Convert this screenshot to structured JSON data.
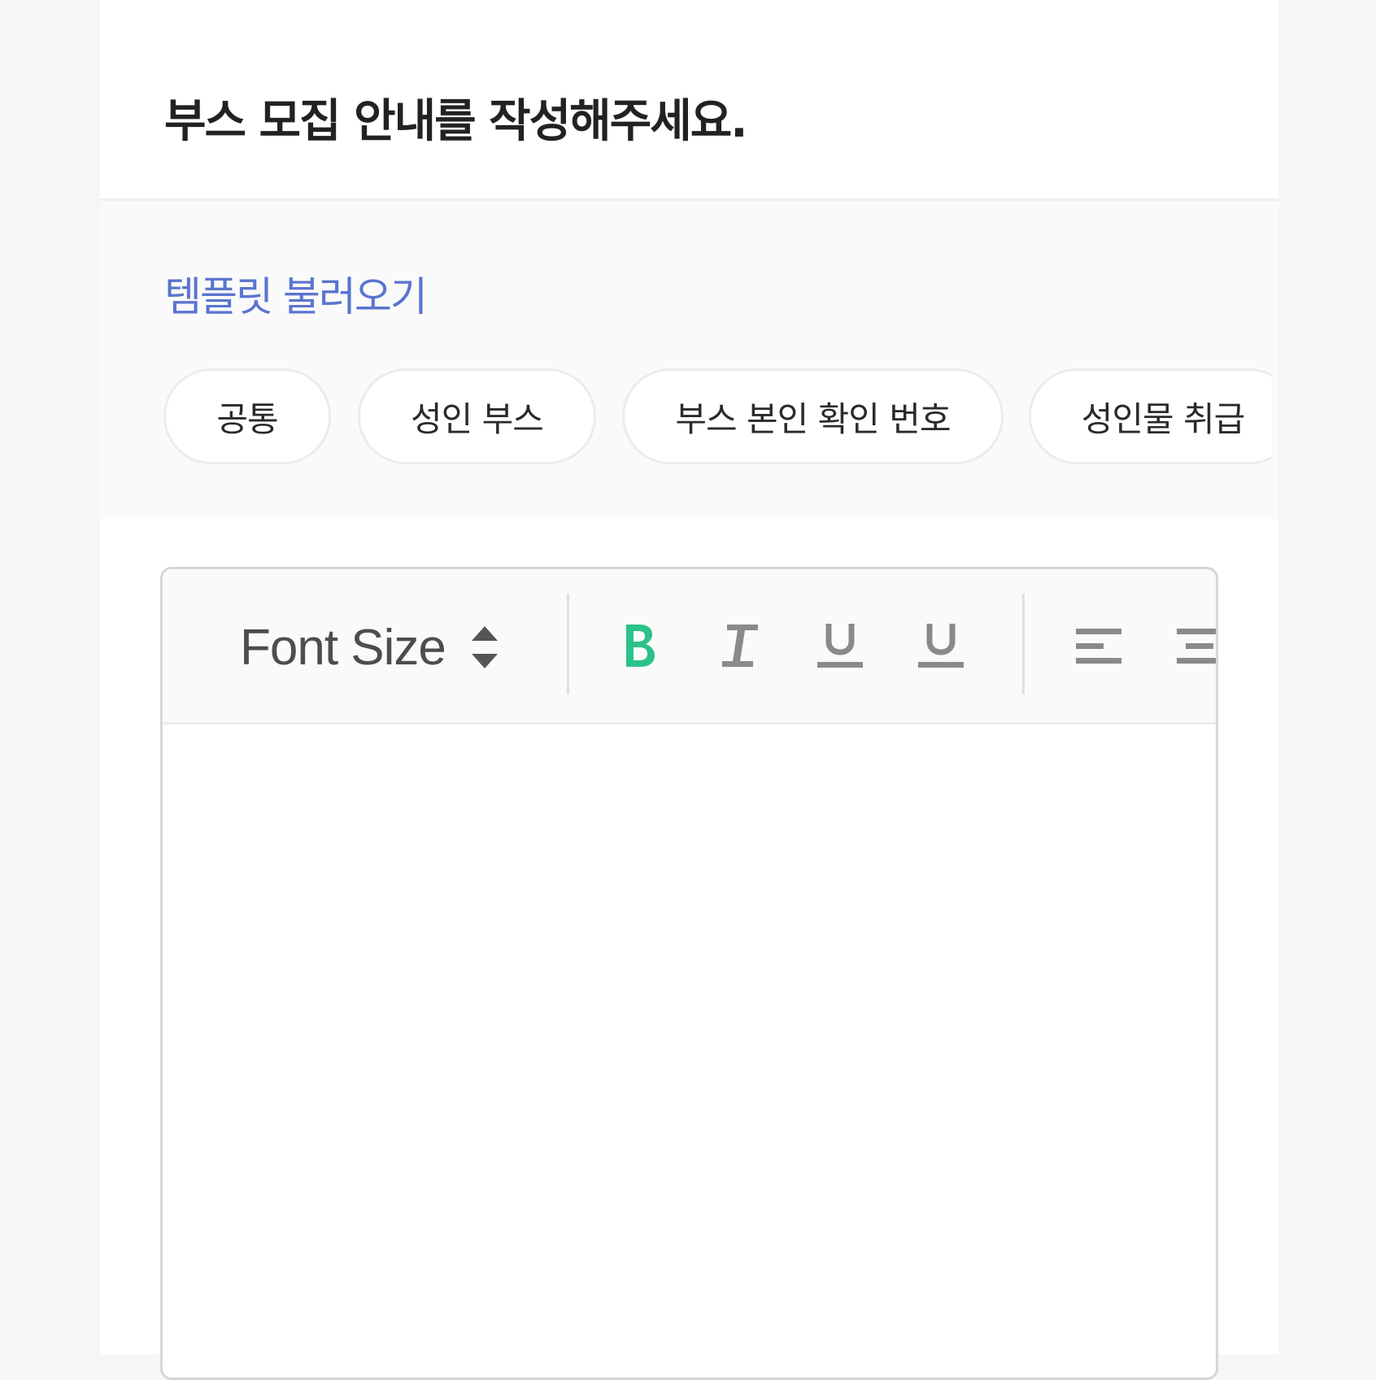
{
  "header": {
    "title": "부스 모집 안내를 작성해주세요."
  },
  "template": {
    "load_label": "템플릿 불러오기",
    "chips": [
      {
        "label": "공통"
      },
      {
        "label": "성인 부스"
      },
      {
        "label": "부스 본인 확인 번호"
      },
      {
        "label": "성인물 취급"
      }
    ]
  },
  "editor": {
    "toolbar": {
      "font_size_label": "Font Size",
      "icons": [
        "sort-arrows-icon",
        "bold-icon",
        "italic-icon",
        "underline-icon",
        "strikethrough-icon",
        "align-left-icon",
        "align-center-icon"
      ]
    },
    "content": ""
  },
  "colors": {
    "accent_link": "#5b74d0",
    "bold_active": "#2cc28a",
    "toolbar_icon": "#8a8a8a",
    "title": "#222222"
  }
}
